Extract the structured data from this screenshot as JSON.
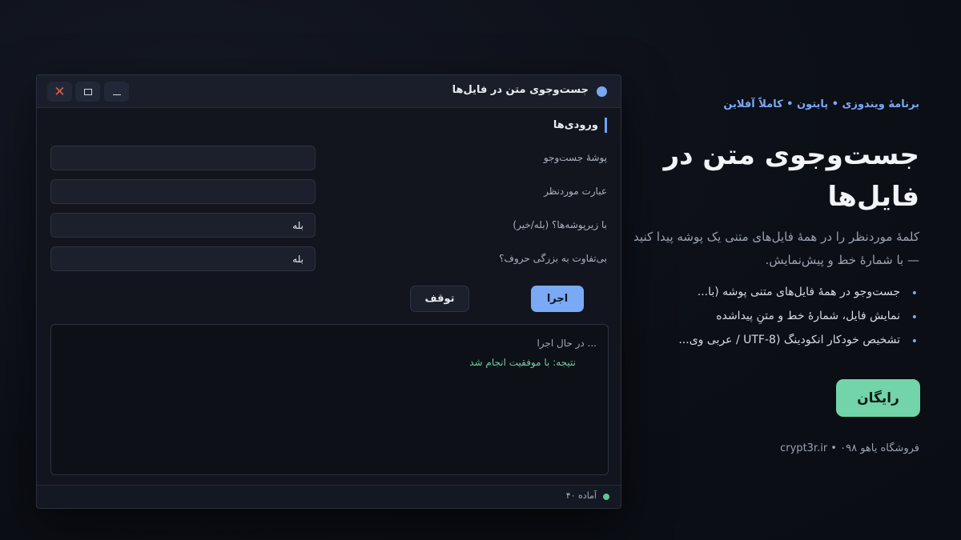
{
  "window": {
    "title": "جست‌وجوی متن در فایل‌ها",
    "section_title": "ورودی‌ها",
    "fields": [
      {
        "label": "پوشهٔ جست‌وجو",
        "value": ""
      },
      {
        "label": "عبارت موردنظر",
        "value": ""
      },
      {
        "label": "با زیرپوشه‌ها؟ (بله/خیر)",
        "value": "بله"
      },
      {
        "label": "بی‌تفاوت به بزرگی حروف؟",
        "value": "بله"
      }
    ],
    "run_label": "اجرا",
    "stop_label": "توقف",
    "log": [
      "... در حال اجرا",
      "نتیجه: با موفقیت انجام شد"
    ],
    "status": "آماده ۴۰"
  },
  "panel": {
    "tagline": "برنامهٔ ویندوزی • پایتون • کاملاً آفلاین",
    "hero": "جست‌وجوی متن در فایل‌ها",
    "description": "کلمهٔ موردنظر را در همهٔ فایل‌های متنی یک پوشه پیدا کنید — با شمارهٔ خط و پیش‌نمایش.",
    "features": [
      "جست‌وجو در همهٔ فایل‌های متنی پوشه (با...",
      "نمایش فایل، شمارهٔ خط و متنِ پیداشده",
      "تشخیص خودکار انکودینگ (UTF-8 / عربی وی..."
    ],
    "price_label": "رایگان",
    "footer": "فروشگاه یاهو ۰۹۸ • crypt3r.ir"
  },
  "colors": {
    "accent": "#7aa9f5",
    "success": "#72d4a8",
    "close": "#e05a4c",
    "background": "#0c0f16"
  }
}
